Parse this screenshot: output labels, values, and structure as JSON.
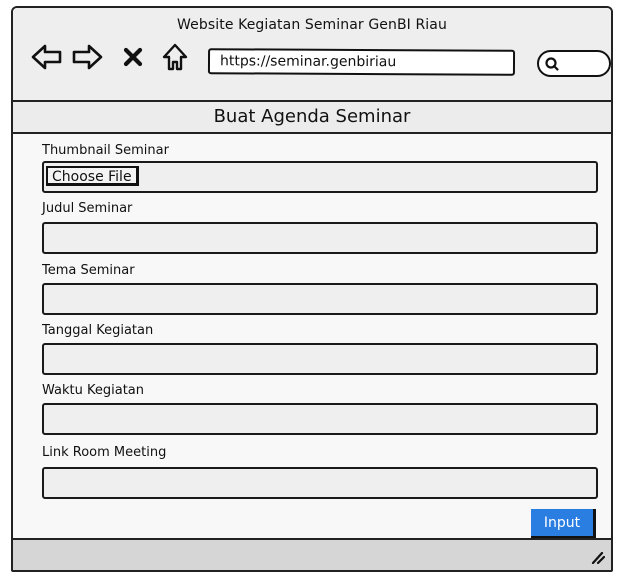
{
  "window": {
    "title": "Website Kegiatan Seminar GenBI Riau"
  },
  "toolbar": {
    "back_icon": "arrow-left-icon",
    "forward_icon": "arrow-right-icon",
    "stop_icon": "close-icon",
    "home_icon": "home-icon",
    "url": "https://seminar.genbiriau",
    "search_icon": "search-icon"
  },
  "page": {
    "heading": "Buat Agenda Seminar"
  },
  "form": {
    "fields": [
      {
        "label": "Thumbnail Seminar",
        "type": "file",
        "button_label": "Choose File"
      },
      {
        "label": "Judul Seminar",
        "type": "text",
        "value": ""
      },
      {
        "label": "Tema Seminar",
        "type": "text",
        "value": ""
      },
      {
        "label": "Tanggal Kegiatan",
        "type": "text",
        "value": ""
      },
      {
        "label": "Waktu Kegiatan",
        "type": "text",
        "value": ""
      },
      {
        "label": "Link Room Meeting",
        "type": "text",
        "value": ""
      }
    ],
    "submit_label": "Input"
  },
  "colors": {
    "accent": "#2a7de1",
    "input_fill": "#efefef",
    "heading_fill": "#ececec",
    "status_bar": "#d6d6d6"
  }
}
